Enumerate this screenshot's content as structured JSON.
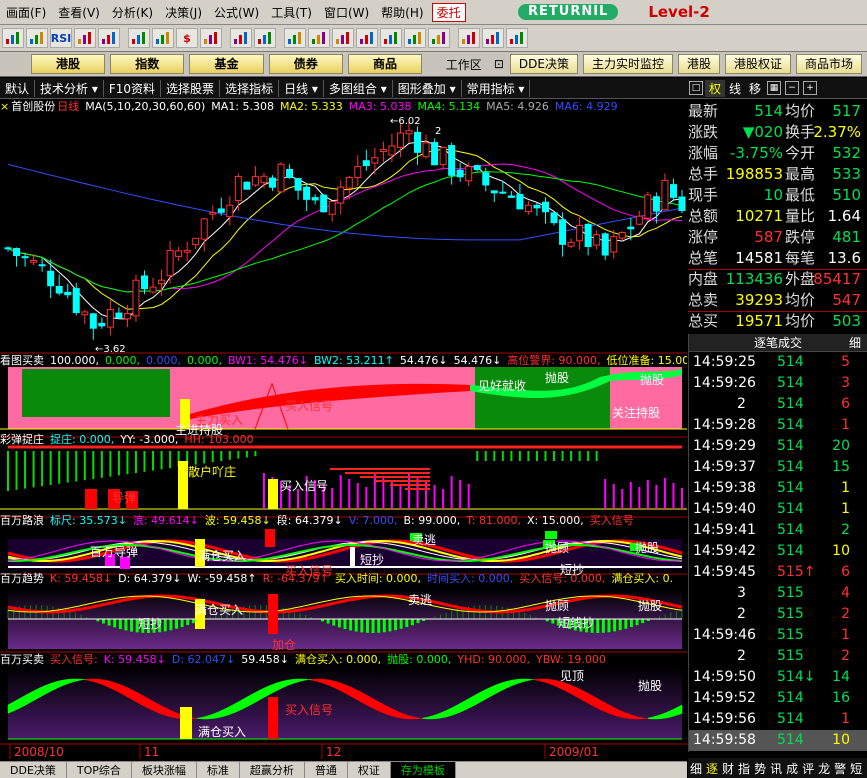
{
  "menu": [
    "画面(F)",
    "查看(V)",
    "分析(K)",
    "决策(J)",
    "公式(W)",
    "工具(T)",
    "窗口(W)",
    "帮助(H)"
  ],
  "menu_special": "委托",
  "brand": {
    "pill": "RETURNIL",
    "level": "Level-2"
  },
  "toolbar_icons": [
    "chart-icon",
    "kline-icon",
    "rsi-icon",
    "bars-icon",
    "f10-icon",
    "cross-icon",
    "ruler-icon",
    "dollar-icon",
    "eye-icon",
    "bar-icon",
    "binoculars-icon",
    "chart-icon",
    "drawing-icon",
    "chart-icon",
    "warning-icon",
    "chart-icon",
    "chart-icon",
    "chart-icon",
    "chart-icon",
    "chart-icon",
    "help-icon"
  ],
  "toolbar_labels": {
    "rsi": "RSI",
    "dollar": "$"
  },
  "nav": {
    "left": [
      "港股",
      "指数",
      "基金",
      "债券",
      "商品"
    ],
    "workspace": "工作区",
    "right": [
      "DDE决策",
      "主力实时监控",
      "港股",
      "港股权证",
      "商品市场"
    ]
  },
  "tabs": [
    "默认",
    "技术分析",
    "F10资料",
    "选择股票",
    "选择指标",
    "日线",
    "多图组合",
    "图形叠加",
    "常用指标"
  ],
  "rtabs": {
    "items": [
      "权",
      "线",
      "移"
    ],
    "active": "权"
  },
  "main_title": {
    "prefix": "首创股份",
    "period": "日线",
    "ma": "MA(5,10,20,30,60,60)",
    "items": [
      {
        "t": "MA1: 5.308",
        "c": "#ffffff"
      },
      {
        "t": "MA2: 5.333",
        "c": "#ffff00"
      },
      {
        "t": "MA3: 5.038",
        "c": "#ff00ff"
      },
      {
        "t": "MA4: 5.134",
        "c": "#00ff00"
      },
      {
        "t": "MA5: 4.926",
        "c": "#aaaaaa"
      },
      {
        "t": "MA6: 4.929",
        "c": "#3050ff"
      }
    ],
    "high_label": "6.02",
    "low_label": "3.62",
    "marker": "2"
  },
  "panels": [
    {
      "name": "看图买卖",
      "items": [
        {
          "t": "看图买卖",
          "c": "#ffffff"
        },
        {
          "t": "100.000,",
          "c": "#ffffff"
        },
        {
          "t": "0.000,",
          "c": "#00ff00"
        },
        {
          "t": "0.000,",
          "c": "#3050ff"
        },
        {
          "t": "0.000,",
          "c": "#00ff00"
        },
        {
          "t": "BW1: 54.476↓",
          "c": "#ff00ff"
        },
        {
          "t": "BW2: 53.211↑",
          "c": "#00ffff"
        },
        {
          "t": "54.476↓",
          "c": "#ffffff"
        },
        {
          "t": "54.476↓",
          "c": "#ffffff"
        },
        {
          "t": "高位警界: 90.000,",
          "c": "#ff3030"
        },
        {
          "t": "低位准备: 15.00",
          "c": "#ffff00"
        }
      ],
      "labels": [
        {
          "t": "见好就收",
          "c": "#ffffff"
        },
        {
          "t": "抛股",
          "c": "#ffffff"
        },
        {
          "t": "抛股",
          "c": "#ffffff"
        },
        {
          "t": "关注持股",
          "c": "#ffffff"
        },
        {
          "t": "买入信号",
          "c": "#ff3030"
        },
        {
          "t": "主力买入",
          "c": "#ff3030"
        },
        {
          "t": "主进持股",
          "c": "#ffffff"
        }
      ]
    },
    {
      "name": "彩弹捉庄",
      "items": [
        {
          "t": "彩弹捉庄",
          "c": "#ffffff"
        },
        {
          "t": "捉庄: 0.000,",
          "c": "#00ffff"
        },
        {
          "t": "YY: -3.000,",
          "c": "#ffffff"
        },
        {
          "t": "HH: 103.000",
          "c": "#ff3030"
        }
      ],
      "labels": [
        {
          "t": "散户吖庄",
          "c": "#ffff00"
        },
        {
          "t": "买入信号",
          "c": "#ffffff"
        },
        {
          "t": "导弹",
          "c": "#ff3030"
        }
      ]
    },
    {
      "name": "百万路浪",
      "items": [
        {
          "t": "百万路浪",
          "c": "#ffffff"
        },
        {
          "t": "标尺: 35.573↓",
          "c": "#00ffff"
        },
        {
          "t": "浪: 49.614↓",
          "c": "#ff00ff"
        },
        {
          "t": "波: 59.458↓",
          "c": "#ffff00"
        },
        {
          "t": "段: 64.379↓",
          "c": "#ffffff"
        },
        {
          "t": "V: 7.000,",
          "c": "#3050ff"
        },
        {
          "t": "B: 99.000,",
          "c": "#ffffff"
        },
        {
          "t": "T: 81.000,",
          "c": "#ff3030"
        },
        {
          "t": "X: 15.000,",
          "c": "#ffffff"
        },
        {
          "t": "买入信号",
          "c": "#ff3030"
        }
      ],
      "labels": [
        {
          "t": "百万导弹",
          "c": "#ffffff"
        },
        {
          "t": "满仓买入",
          "c": "#ffffff"
        },
        {
          "t": "短抄",
          "c": "#ffffff"
        },
        {
          "t": "卖逃",
          "c": "#ffffff"
        },
        {
          "t": "抛顾",
          "c": "#ffffff"
        },
        {
          "t": "抛股",
          "c": "#ffffff"
        },
        {
          "t": "短抄",
          "c": "#ffffff"
        },
        {
          "t": "买入信号",
          "c": "#ff3030"
        }
      ]
    },
    {
      "name": "百万趋势",
      "items": [
        {
          "t": "百万趋势",
          "c": "#ffffff"
        },
        {
          "t": "K: 59.458↓",
          "c": "#ff3030"
        },
        {
          "t": "D: 64.379↓",
          "c": "#ffffff"
        },
        {
          "t": "W: -59.458↑",
          "c": "#ffffff"
        },
        {
          "t": "R: -64.379↑",
          "c": "#ff3030"
        },
        {
          "t": "买入时间: 0.000,",
          "c": "#ffff00"
        },
        {
          "t": "时间买入: 0.000,",
          "c": "#3050ff"
        },
        {
          "t": "买入信号: 0.000,",
          "c": "#ff3030"
        },
        {
          "t": "满仓买入: 0.",
          "c": "#ffff00"
        }
      ],
      "labels": [
        {
          "t": "满仓买入",
          "c": "#ffffff"
        },
        {
          "t": "短抄",
          "c": "#ffffff"
        },
        {
          "t": "卖逃",
          "c": "#ffffff"
        },
        {
          "t": "抛顾",
          "c": "#ffffff"
        },
        {
          "t": "抛股",
          "c": "#ffffff"
        },
        {
          "t": "短线抄",
          "c": "#ffffff"
        },
        {
          "t": "加仓",
          "c": "#ff3030"
        }
      ]
    },
    {
      "name": "百万买卖",
      "items": [
        {
          "t": "百万买卖",
          "c": "#ffffff"
        },
        {
          "t": "买入信号:",
          "c": "#ff3030"
        },
        {
          "t": "K: 59.458↓",
          "c": "#ff00ff"
        },
        {
          "t": "D: 62.047↓",
          "c": "#3050ff"
        },
        {
          "t": "59.458↓",
          "c": "#ffffff"
        },
        {
          "t": "满仓买入: 0.000,",
          "c": "#ffff00"
        },
        {
          "t": "抛股: 0.000,",
          "c": "#00ff00"
        },
        {
          "t": "YHD: 90.000,",
          "c": "#ff3030"
        },
        {
          "t": "YBW: 19.000",
          "c": "#ff3030"
        }
      ],
      "labels": [
        {
          "t": "满仓买入",
          "c": "#ffffff"
        },
        {
          "t": "买入信号",
          "c": "#ff3030"
        },
        {
          "t": "见顶",
          "c": "#ffffff"
        },
        {
          "t": "抛股",
          "c": "#ffffff"
        }
      ]
    }
  ],
  "dates": [
    "2008/10",
    "11",
    "12",
    "2009/01"
  ],
  "quote": [
    {
      "a": "最新",
      "b": "514",
      "bc": "grn",
      "c": "均价",
      "d": "517",
      "dc": "grn"
    },
    {
      "a": "涨跌",
      "b": "▼020",
      "bc": "grn",
      "c": "换手",
      "d": "2.37%",
      "dc": "yel"
    },
    {
      "a": "涨幅",
      "b": "-3.75%",
      "bc": "grn",
      "c": "今开",
      "d": "532",
      "dc": "grn"
    },
    {
      "a": "总手",
      "b": "198853",
      "bc": "yel",
      "c": "最高",
      "d": "533",
      "dc": "grn"
    },
    {
      "a": "现手",
      "b": "10",
      "bc": "grn",
      "c": "最低",
      "d": "510",
      "dc": "grn"
    },
    {
      "a": "总额",
      "b": "10271",
      "bc": "yel",
      "c": "量比",
      "d": "1.64",
      "dc": "wht"
    },
    {
      "a": "涨停",
      "b": "587",
      "bc": "red",
      "c": "跌停",
      "d": "481",
      "dc": "grn"
    },
    {
      "a": "总笔",
      "b": "14581",
      "bc": "wht",
      "c": "每笔",
      "d": "13.6",
      "dc": "wht"
    },
    {
      "a": "内盘",
      "b": "113436",
      "bc": "grn",
      "c": "外盘",
      "d": "85417",
      "dc": "red"
    },
    {
      "a": "总卖",
      "b": "39293",
      "bc": "yel",
      "c": "均价",
      "d": "547",
      "dc": "red"
    },
    {
      "a": "总买",
      "b": "19571",
      "bc": "yel",
      "c": "均价",
      "d": "503",
      "dc": "grn"
    }
  ],
  "trades_header": "逐笔成交",
  "trades_header_btn": "细",
  "trades": [
    {
      "t": "14:59:25",
      "p": "514",
      "pc": "grn",
      "v": "5",
      "vc": "red"
    },
    {
      "t": "14:59:26",
      "p": "514",
      "pc": "grn",
      "v": "3",
      "vc": "red"
    },
    {
      "t": "2",
      "p": "514",
      "pc": "grn",
      "v": "6",
      "vc": "red",
      "tc": "yel"
    },
    {
      "t": "14:59:28",
      "p": "514",
      "pc": "grn",
      "v": "1",
      "vc": "red"
    },
    {
      "t": "14:59:29",
      "p": "514",
      "pc": "grn",
      "v": "20",
      "vc": "grn"
    },
    {
      "t": "14:59:37",
      "p": "514",
      "pc": "grn",
      "v": "15",
      "vc": "grn"
    },
    {
      "t": "14:59:38",
      "p": "514",
      "pc": "grn",
      "v": "1",
      "vc": "yel"
    },
    {
      "t": "14:59:40",
      "p": "514",
      "pc": "grn",
      "v": "1",
      "vc": "yel"
    },
    {
      "t": "14:59:41",
      "p": "514",
      "pc": "grn",
      "v": "2",
      "vc": "grn"
    },
    {
      "t": "14:59:42",
      "p": "514",
      "pc": "grn",
      "v": "10",
      "vc": "yel"
    },
    {
      "t": "14:59:45",
      "p": "515↑",
      "pc": "red",
      "v": "6",
      "vc": "red"
    },
    {
      "t": "3",
      "p": "515",
      "pc": "grn",
      "v": "4",
      "vc": "red",
      "tc": "yel"
    },
    {
      "t": "2",
      "p": "515",
      "pc": "grn",
      "v": "2",
      "vc": "red",
      "tc": "yel"
    },
    {
      "t": "14:59:46",
      "p": "515",
      "pc": "grn",
      "v": "1",
      "vc": "red"
    },
    {
      "t": "2",
      "p": "515",
      "pc": "grn",
      "v": "2",
      "vc": "red",
      "tc": "yel"
    },
    {
      "t": "14:59:50",
      "p": "514↓",
      "pc": "grn",
      "v": "14",
      "vc": "grn"
    },
    {
      "t": "14:59:52",
      "p": "514",
      "pc": "grn",
      "v": "16",
      "vc": "grn"
    },
    {
      "t": "14:59:56",
      "p": "514",
      "pc": "grn",
      "v": "1",
      "vc": "red"
    },
    {
      "t": "14:59:58",
      "p": "514",
      "pc": "grn",
      "v": "10",
      "vc": "yel",
      "sel": true
    }
  ],
  "rbottom": {
    "items": [
      "细",
      "逐",
      "财",
      "指",
      "势",
      "讯",
      "成",
      "评",
      "龙",
      "警",
      "短"
    ],
    "active": "逐"
  },
  "bottom": {
    "items": [
      "DDE决策",
      "TOP综合",
      "板块涨幅",
      "标准",
      "超赢分析",
      "普通",
      "权证",
      "存为模板"
    ],
    "active": "存为模板"
  }
}
